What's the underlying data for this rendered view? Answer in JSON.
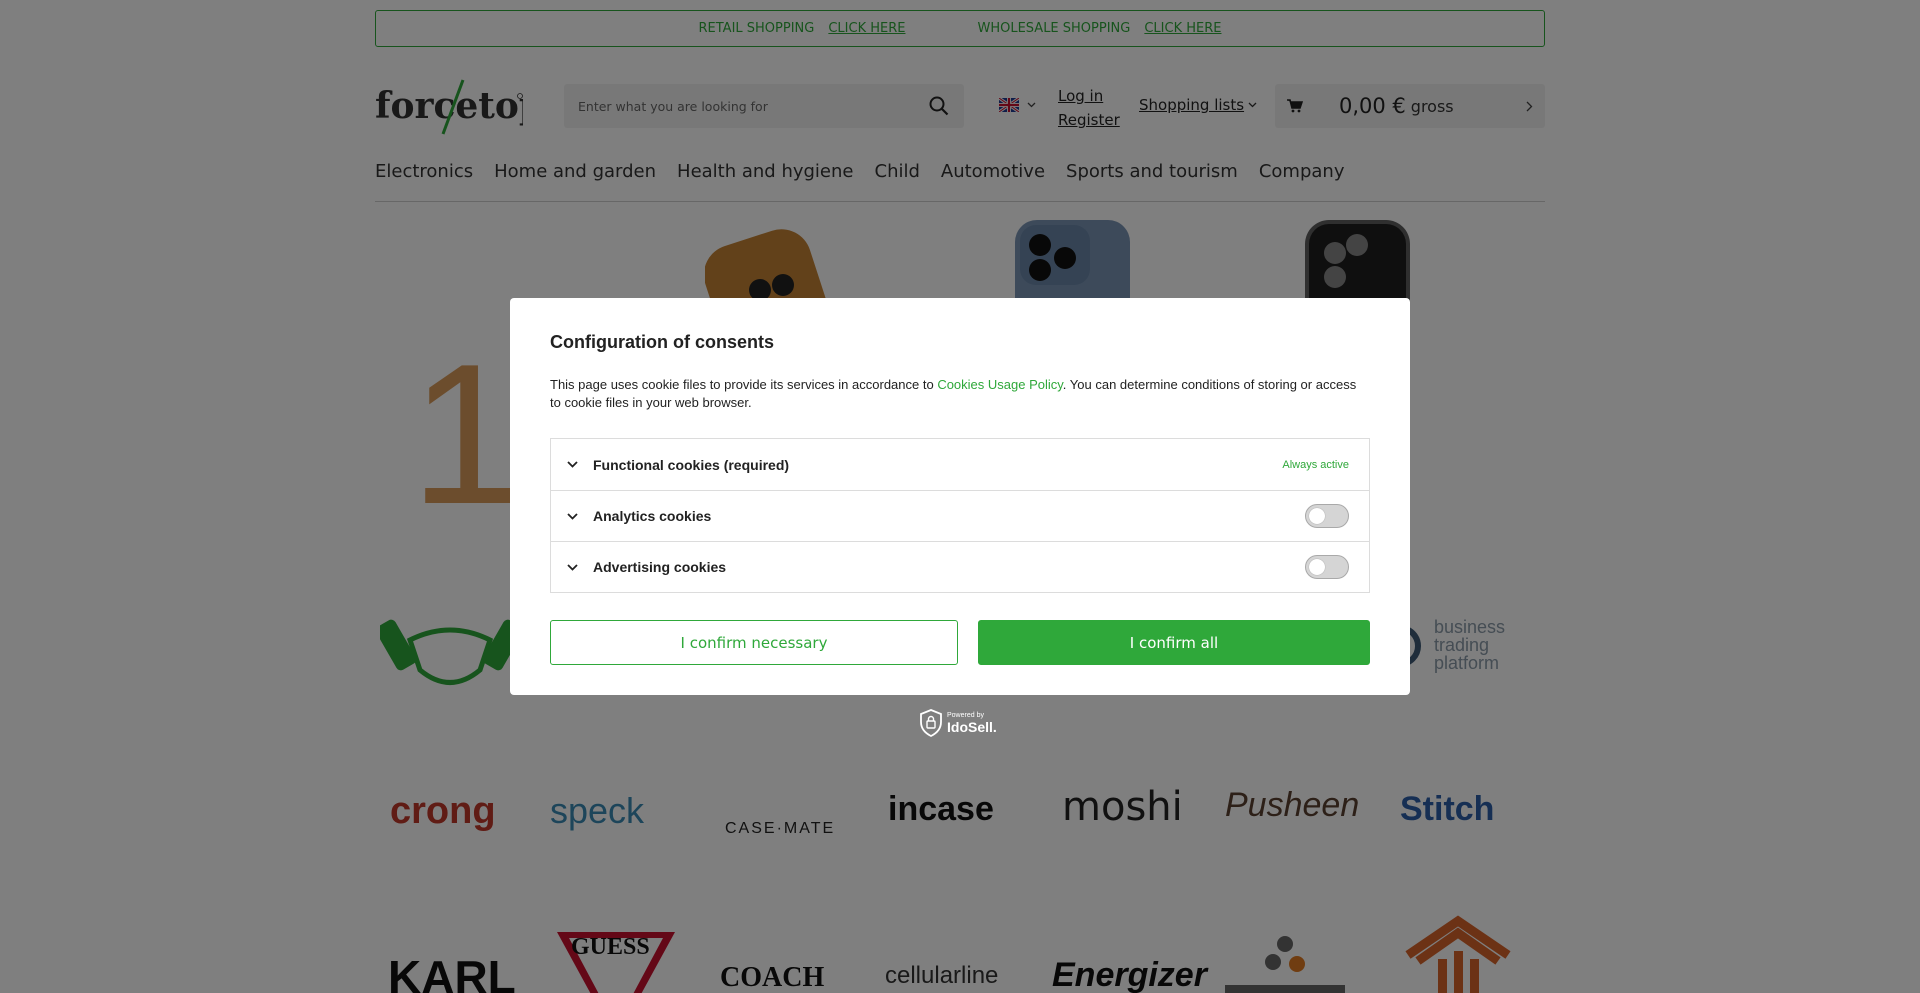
{
  "topbar": {
    "retail_label": "RETAIL SHOPPING",
    "retail_link": "CLICK HERE",
    "wholesale_label": "WHOLESALE SHOPPING",
    "wholesale_link": "CLICK HERE"
  },
  "header": {
    "logo_text": "forcetop",
    "search_placeholder": "Enter what you are looking for",
    "login": "Log in",
    "register": "Register",
    "shopping_lists": "Shopping lists",
    "basket_price": "0,00 €",
    "basket_gross": "gross"
  },
  "nav": [
    "Electronics",
    "Home and garden",
    "Health and hygiene",
    "Child",
    "Automotive",
    "Sports and tourism",
    "Company"
  ],
  "background": {
    "promo_digit": "1",
    "btp_line1": "business",
    "btp_line2": "trading",
    "btp_line3": "platform",
    "brands_row1": [
      "crong",
      "speck",
      "CASE·MATE",
      "incase",
      "moshi",
      "Pusheen",
      "Stitch"
    ],
    "brands_row2": [
      "KARL",
      "GUESS",
      "COACH",
      "cellularline",
      "Energizer"
    ]
  },
  "consent": {
    "title": "Configuration of consents",
    "text_before": "This page uses cookie files to provide its services in accordance to ",
    "policy_link": "Cookies Usage Policy",
    "text_after": ". You can determine conditions of storing or access to cookie files in your web browser.",
    "categories": [
      {
        "label": "Functional cookies (required)",
        "status": "Always active"
      },
      {
        "label": "Analytics cookies",
        "enabled": false
      },
      {
        "label": "Advertising cookies",
        "enabled": false
      }
    ],
    "btn_necessary": "I confirm necessary",
    "btn_all": "I confirm all",
    "powered_by": "Powered by",
    "powered_brand": "IdoSell."
  },
  "colors": {
    "accent": "#2fa83a",
    "overlay": "rgba(0,0,0,0.5)"
  }
}
